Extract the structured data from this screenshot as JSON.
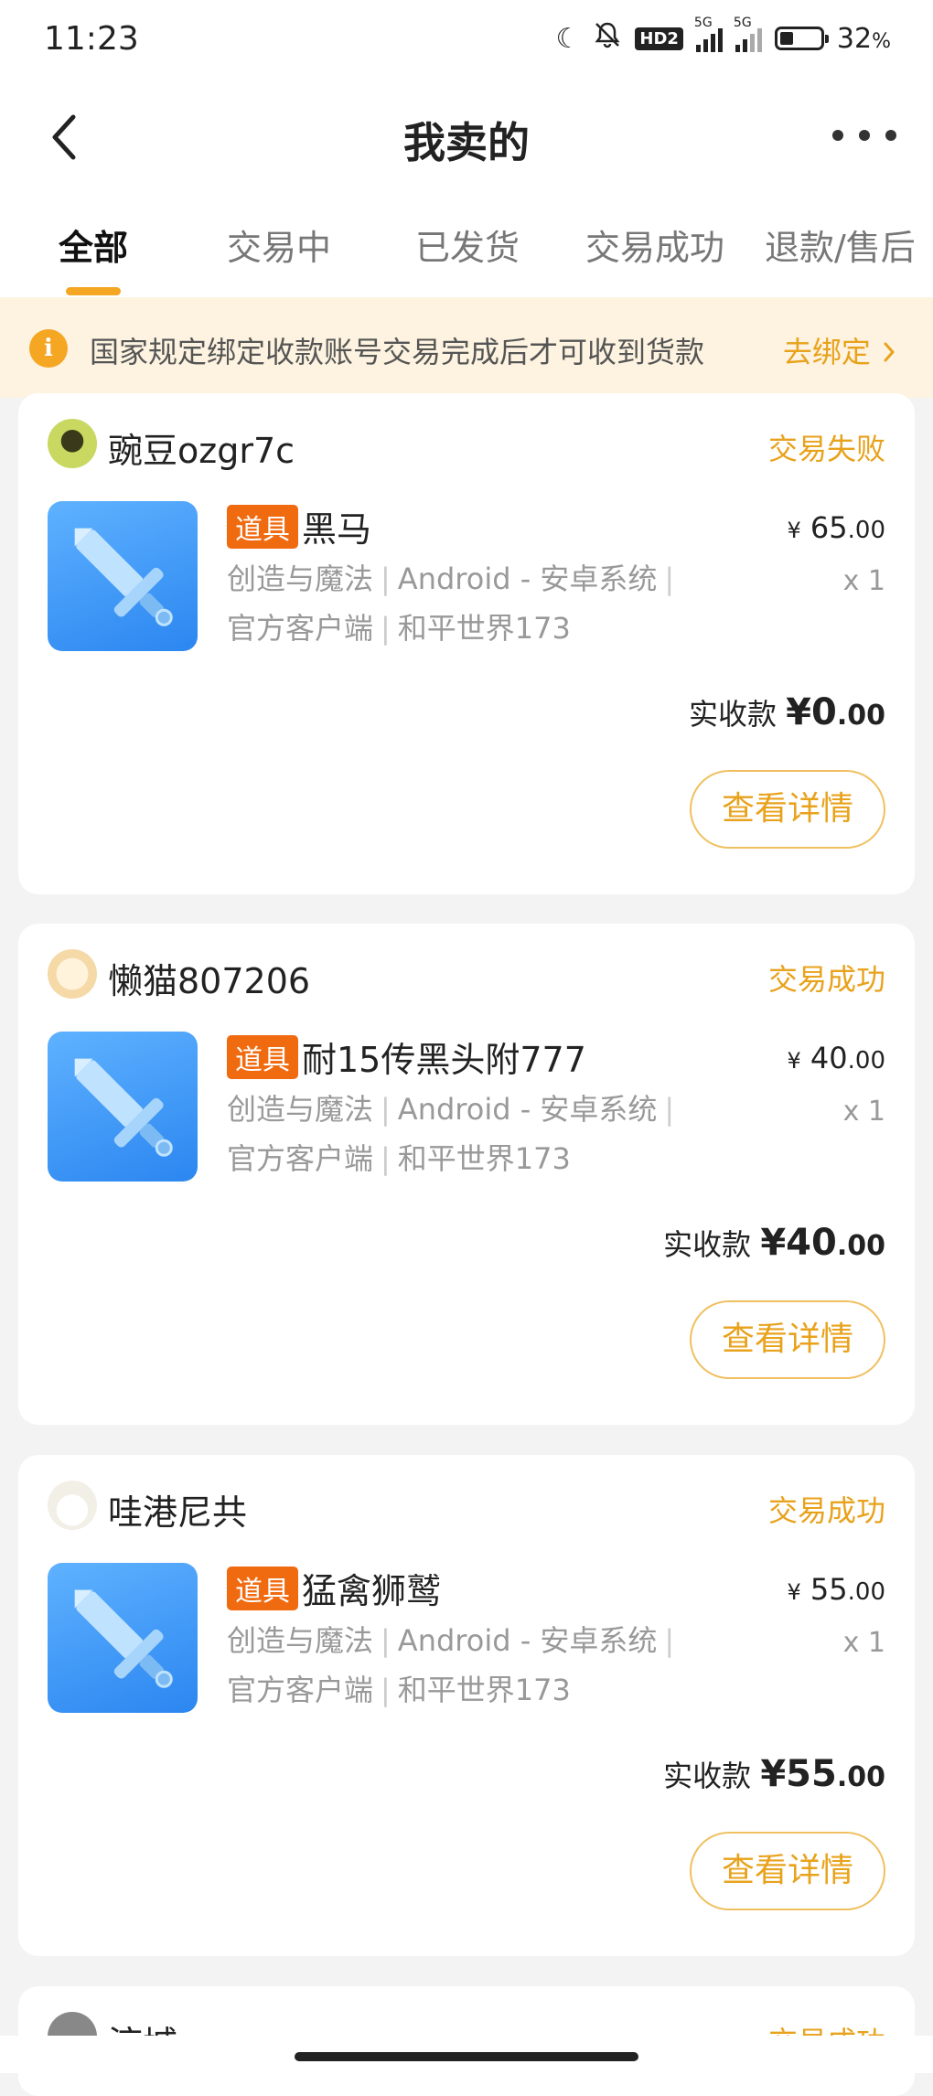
{
  "status_bar": {
    "time": "11:23",
    "battery_percent": "32",
    "battery_level": 0.32,
    "network_labels": [
      "5G",
      "5G"
    ],
    "hd_badge": "HD2"
  },
  "header": {
    "title": "我卖的"
  },
  "tabs": [
    {
      "label": "全部",
      "active": true
    },
    {
      "label": "交易中",
      "active": false
    },
    {
      "label": "已发货",
      "active": false
    },
    {
      "label": "交易成功",
      "active": false
    },
    {
      "label": "退款/售后",
      "active": false
    }
  ],
  "notice": {
    "icon_text": "i",
    "text": "国家规定绑定收款账号交易完成后才可收到货款",
    "link": "去绑定"
  },
  "orders": [
    {
      "seller": "豌豆ozgr7c",
      "status": "交易失败",
      "tag": "道具",
      "title": "黑马",
      "meta1": "创造与魔法",
      "meta2": "Android - 安卓系统",
      "meta3": "官方客户端",
      "meta4": "和平世界173",
      "currency": "¥",
      "price_int": "65",
      "price_dec": ".00",
      "qty": "x 1",
      "received_label": "实收款",
      "received_int": "¥0",
      "received_dec": ".00",
      "button": "查看详情"
    },
    {
      "seller": "懒猫807206",
      "status": "交易成功",
      "tag": "道具",
      "title": "耐15传黑头附777",
      "meta1": "创造与魔法",
      "meta2": "Android - 安卓系统",
      "meta3": "官方客户端",
      "meta4": "和平世界173",
      "currency": "¥",
      "price_int": "40",
      "price_dec": ".00",
      "qty": "x 1",
      "received_label": "实收款",
      "received_int": "¥40",
      "received_dec": ".00",
      "button": "查看详情"
    },
    {
      "seller": "哇港尼共",
      "status": "交易成功",
      "tag": "道具",
      "title": "猛禽狮鹫",
      "meta1": "创造与魔法",
      "meta2": "Android - 安卓系统",
      "meta3": "官方客户端",
      "meta4": "和平世界173",
      "currency": "¥",
      "price_int": "55",
      "price_dec": ".00",
      "qty": "x 1",
      "received_label": "实收款",
      "received_int": "¥55",
      "received_dec": ".00",
      "button": "查看详情"
    }
  ],
  "partial_card": {
    "seller": "涼城",
    "status": "交易成功"
  },
  "colors": {
    "accent": "#e8a21c",
    "tag": "#f06a0f",
    "notice_bg": "#fdf3e0",
    "thumb": "#3a95f5"
  }
}
